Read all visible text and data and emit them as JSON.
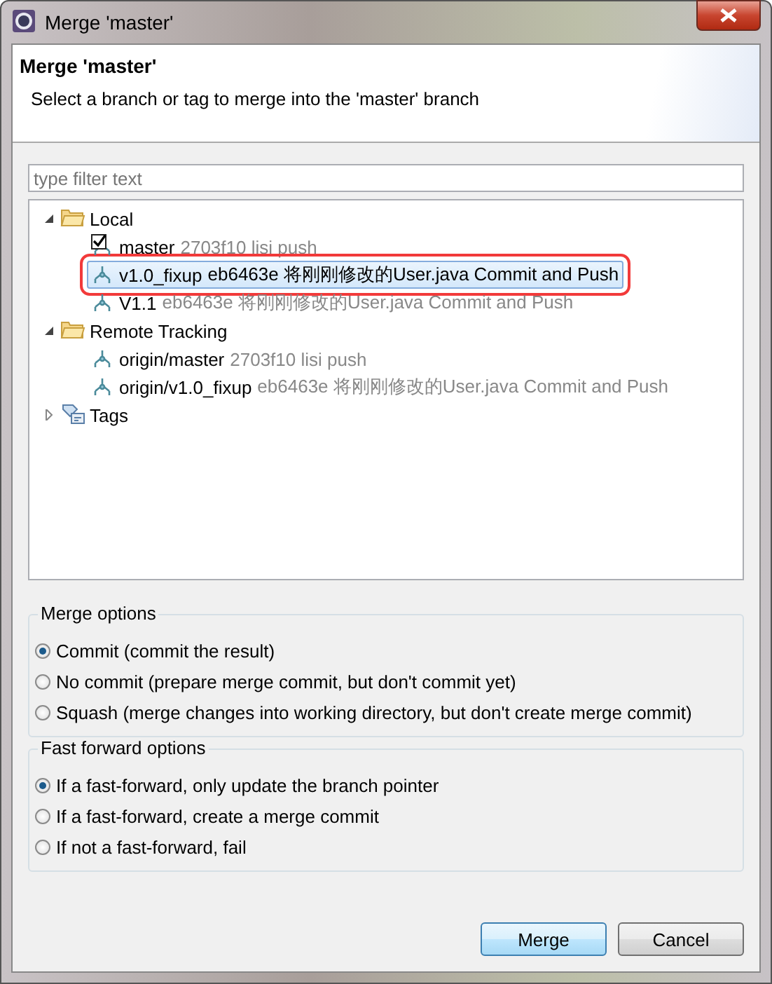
{
  "window": {
    "title": "Merge 'master'"
  },
  "header": {
    "title": "Merge 'master'",
    "description": "Select a branch or tag to merge into the 'master' branch"
  },
  "filter": {
    "placeholder": "type filter text"
  },
  "tree": [
    {
      "label": "Local",
      "kind": "folder",
      "expanded": true,
      "children": [
        {
          "name": "master",
          "commit": "2703f10 lisi push",
          "checked_out": true,
          "selected": false,
          "outlined": false
        },
        {
          "name": "v1.0_fixup",
          "commit": "eb6463e 将刚刚修改的User.java Commit and Push",
          "checked_out": false,
          "selected": true,
          "outlined": true
        },
        {
          "name": "V1.1",
          "commit": "eb6463e 将刚刚修改的User.java Commit and Push",
          "checked_out": false,
          "selected": false,
          "outlined": false
        }
      ]
    },
    {
      "label": "Remote Tracking",
      "kind": "folder",
      "expanded": true,
      "children": [
        {
          "name": "origin/master",
          "commit": "2703f10 lisi push",
          "checked_out": false,
          "selected": false,
          "outlined": false
        },
        {
          "name": "origin/v1.0_fixup",
          "commit": "eb6463e 将刚刚修改的User.java Commit and Push",
          "checked_out": false,
          "selected": false,
          "outlined": false
        }
      ]
    },
    {
      "label": "Tags",
      "kind": "tags",
      "expanded": false
    }
  ],
  "groups": [
    {
      "title": "Merge options",
      "options": [
        {
          "label": "Commit (commit the result)",
          "selected": true
        },
        {
          "label": "No commit (prepare merge commit, but don't commit yet)",
          "selected": false
        },
        {
          "label": "Squash (merge changes into working directory, but don't create merge commit)",
          "selected": false
        }
      ]
    },
    {
      "title": "Fast forward options",
      "options": [
        {
          "label": "If a fast-forward, only update the branch pointer",
          "selected": true
        },
        {
          "label": "If a fast-forward, create a merge commit",
          "selected": false
        },
        {
          "label": "If not a fast-forward, fail",
          "selected": false
        }
      ]
    }
  ],
  "buttons": [
    {
      "label": "Merge",
      "default": true
    },
    {
      "label": "Cancel",
      "default": false
    }
  ]
}
